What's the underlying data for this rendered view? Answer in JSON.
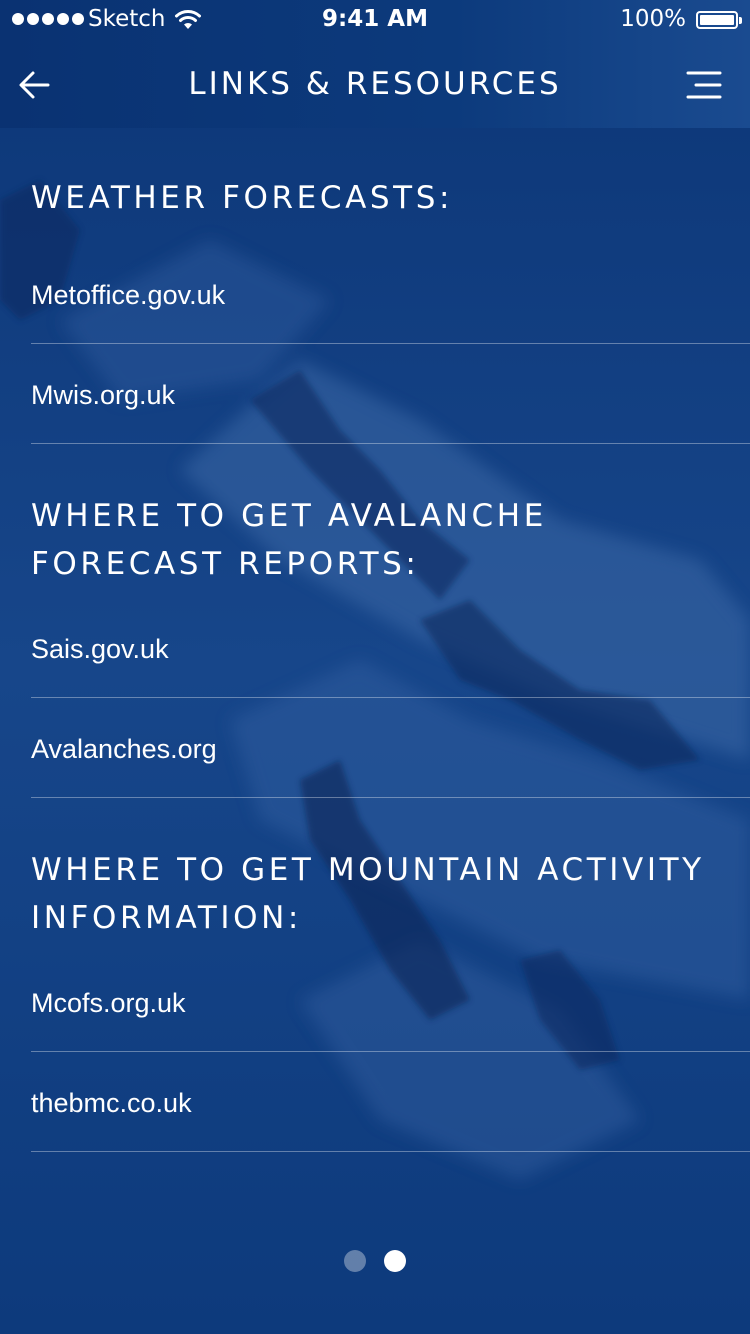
{
  "status_bar": {
    "carrier": "Sketch",
    "time": "9:41 AM",
    "battery": "100%"
  },
  "nav": {
    "title": "LINKS & RESOURCES",
    "back_icon": "arrow-left-icon",
    "menu_icon": "menu-icon"
  },
  "sections": [
    {
      "heading": "WEATHER FORECASTS:",
      "links": [
        "Metoffice.gov.uk",
        "Mwis.org.uk"
      ]
    },
    {
      "heading": "WHERE TO GET AVALANCHE FORECAST REPORTS:",
      "links": [
        "Sais.gov.uk",
        "Avalanches.org"
      ]
    },
    {
      "heading": "WHERE TO GET MOUNTAIN ACTIVITY INFORMATION:",
      "links": [
        "Mcofs.org.uk",
        "thebmc.co.uk"
      ]
    }
  ],
  "pager": {
    "pages": 2,
    "current_page": 2
  },
  "colors": {
    "background": "#0f3a78",
    "text": "#ffffff",
    "divider": "rgba(255,255,255,0.35)"
  }
}
